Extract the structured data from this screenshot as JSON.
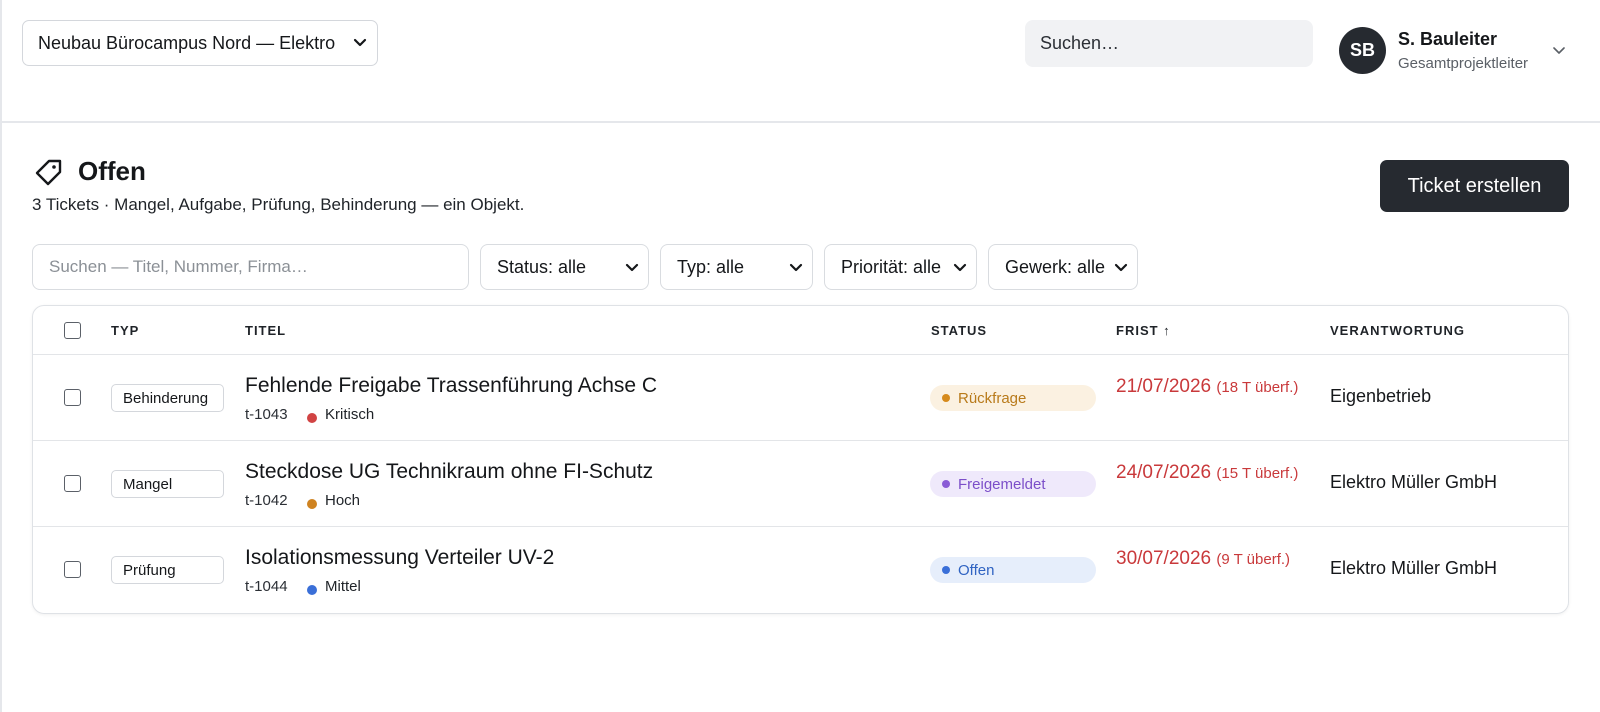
{
  "header": {
    "project_select": "Neubau Bürocampus Nord — Elektro",
    "search_placeholder": "Suchen…",
    "user": {
      "initials": "SB",
      "name": "S. Bauleiter",
      "role": "Gesamtprojektleiter"
    }
  },
  "page": {
    "title": "Offen",
    "subtitle": "3 Tickets · Mangel, Aufgabe, Prüfung, Behinderung — ein Objekt.",
    "create_button": "Ticket erstellen"
  },
  "filters": {
    "search_placeholder": "Suchen — Titel, Nummer, Firma…",
    "status": "Status: alle",
    "type": "Typ: alle",
    "priority": "Priorität: alle",
    "trade": "Gewerk: alle"
  },
  "table": {
    "columns": {
      "type": "TYP",
      "title": "TITEL",
      "status": "STATUS",
      "deadline": "FRIST ↑",
      "owner": "VERANTWORTUNG"
    },
    "rows": [
      {
        "type": "Behinderung",
        "title": "Fehlende Freigabe Trassenführung Achse C",
        "number": "t-1043",
        "priority": "Kritisch",
        "priority_color": "#d14343",
        "status": "Rückfrage",
        "status_bg": "#fbf1e1",
        "status_fg": "#b87a1a",
        "status_dot": "#d68a1c",
        "deadline": "21/07/2026",
        "overdue": "(18 T überf.)",
        "owner": "Eigenbetrieb"
      },
      {
        "type": "Mangel",
        "title": "Steckdose UG Technikraum ohne FI-Schutz",
        "number": "t-1042",
        "priority": "Hoch",
        "priority_color": "#cf8321",
        "status": "Freigemeldet",
        "status_bg": "#efe9fb",
        "status_fg": "#7c4fc9",
        "status_dot": "#8a5cd6",
        "deadline": "24/07/2026",
        "overdue": "(15 T überf.)",
        "owner": "Elektro Müller GmbH"
      },
      {
        "type": "Prüfung",
        "title": "Isolationsmessung Verteiler UV-2",
        "number": "t-1044",
        "priority": "Mittel",
        "priority_color": "#3a6fd8",
        "status": "Offen",
        "status_bg": "#e6eefb",
        "status_fg": "#2f63c2",
        "status_dot": "#3a6fd8",
        "deadline": "30/07/2026",
        "overdue": "(9 T überf.)",
        "owner": "Elektro Müller GmbH"
      }
    ]
  }
}
